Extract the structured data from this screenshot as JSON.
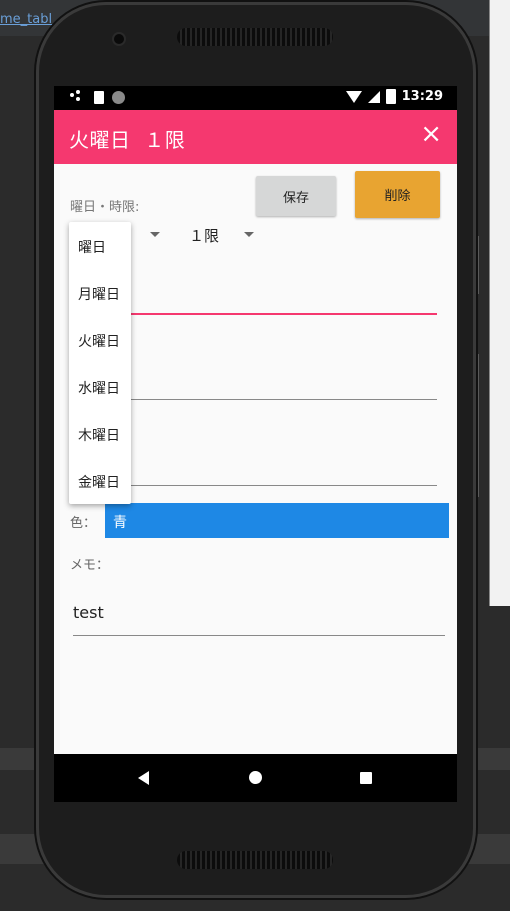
{
  "ide": {
    "tab_label": "me_tabl"
  },
  "status_bar": {
    "time": "13:29",
    "icons": [
      "notification-dots-icon",
      "sd-card-icon",
      "sync-icon",
      "wifi-icon",
      "signal-icon",
      "battery-icon"
    ]
  },
  "app_bar": {
    "title": "火曜日  １限",
    "close_icon": "×",
    "color": "#f5386f"
  },
  "form": {
    "day_period_label": "曜日・時限:",
    "save_label": "保存",
    "delete_label": "削除",
    "period_value": "１限",
    "color_label": "色：",
    "color_value": "青",
    "color_value_hex": "#1e88e5",
    "memo_label": "メモ：",
    "memo_value": "test"
  },
  "day_dropdown": {
    "options": [
      "曜日",
      "月曜日",
      "火曜日",
      "水曜日",
      "木曜日",
      "金曜日"
    ]
  },
  "nav_bar": {
    "icons": [
      "back-icon",
      "home-icon",
      "recents-icon"
    ]
  }
}
